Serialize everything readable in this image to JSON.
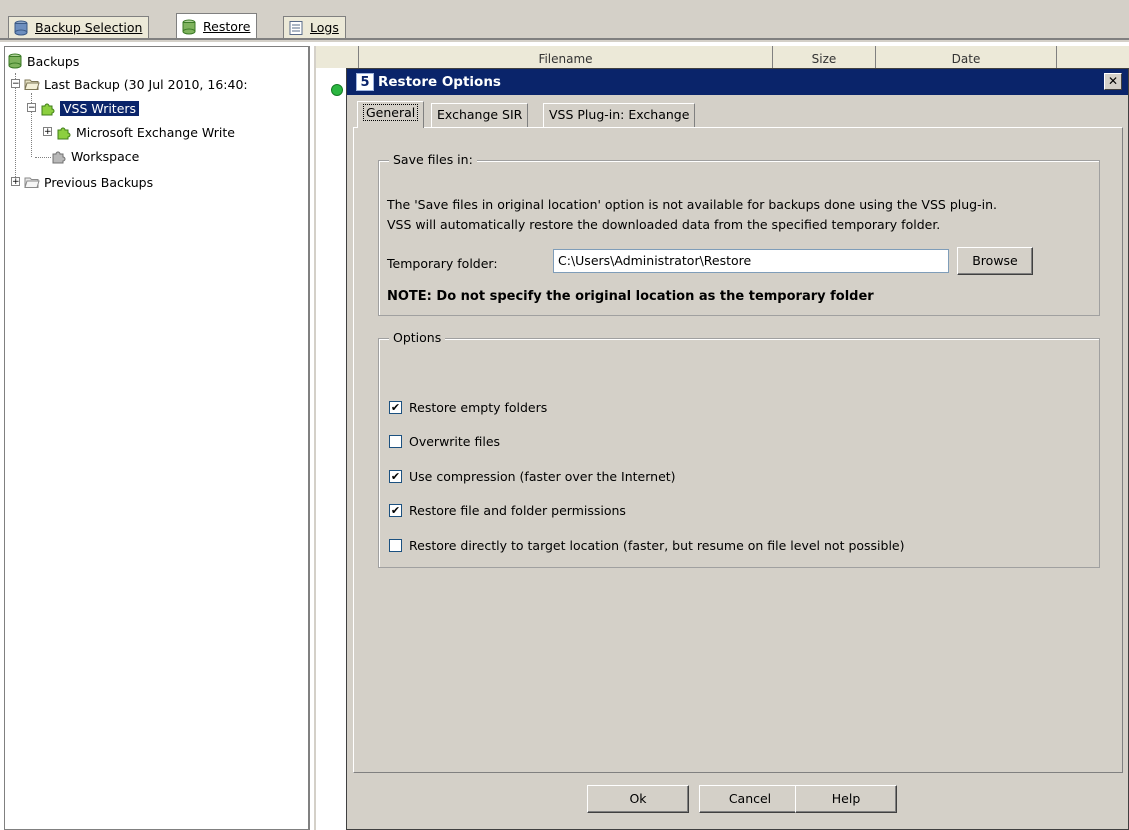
{
  "tabs": [
    {
      "label": "Backup Selection",
      "icon": "database-icon",
      "active": false
    },
    {
      "label": "Restore",
      "icon": "database-icon",
      "active": true
    },
    {
      "label": "Logs",
      "icon": "document-icon",
      "active": false
    }
  ],
  "tree": {
    "root": "Backups",
    "last_backup": "Last Backup (30 Jul 2010, 16:40:",
    "vss_writers": "VSS Writers",
    "exchange_writer": "Microsoft Exchange Write",
    "workspace": "Workspace",
    "previous_backups": "Previous Backups"
  },
  "file_list": {
    "columns": [
      "Filename",
      "Size",
      "Date"
    ]
  },
  "dialog": {
    "title": "Restore Options",
    "app_icon_char": "5",
    "close_label": "✕",
    "tabs": [
      "General",
      "Exchange SIR",
      "VSS Plug-in: Exchange"
    ],
    "save_group_label": "Save files in:",
    "info_line1": "The 'Save files in original location' option is not available for backups done using the VSS plug-in.",
    "info_line2": "VSS will automatically restore the downloaded data from the specified temporary folder.",
    "temp_folder_label": "Temporary folder:",
    "temp_folder_value": "C:\\Users\\Administrator\\Restore",
    "browse_label": "Browse",
    "note": "NOTE: Do not specify the original location as the temporary folder",
    "options_group_label": "Options",
    "options": [
      {
        "label": "Restore empty folders",
        "checked": true
      },
      {
        "label": "Overwrite files",
        "checked": false
      },
      {
        "label": "Use compression (faster over the Internet)",
        "checked": true
      },
      {
        "label": "Restore file and folder permissions",
        "checked": true
      },
      {
        "label": "Restore directly to target location (faster, but resume on file level not possible)",
        "checked": false
      }
    ],
    "ok_label": "Ok",
    "cancel_label": "Cancel",
    "help_label": "Help"
  },
  "colors": {
    "titlebar": "#0a246a",
    "dialog_bg": "#d4d0c8",
    "selection": "#0a246a",
    "status_green": "#2bb640"
  }
}
